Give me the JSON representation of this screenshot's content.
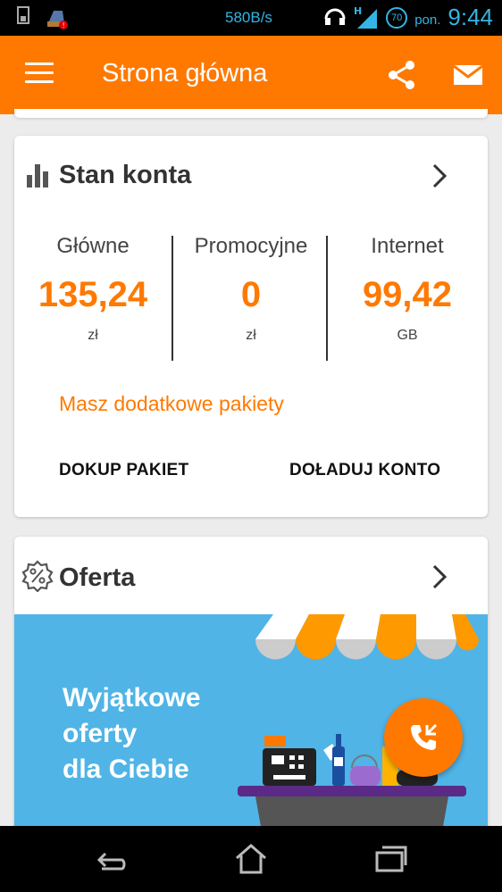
{
  "status_bar": {
    "net_speed": "580B/s",
    "battery": "70",
    "day": "pon.",
    "time": "9:44"
  },
  "app_bar": {
    "title": "Strona główna",
    "accent": "#ff7900"
  },
  "account_card": {
    "title": "Stan konta",
    "balances": [
      {
        "label": "Główne",
        "value": "135,24",
        "unit": "zł"
      },
      {
        "label": "Promocyjne",
        "value": "0",
        "unit": "zł"
      },
      {
        "label": "Internet",
        "value": "99,42",
        "unit": "GB"
      }
    ],
    "extra_packages_link": "Masz dodatkowe pakiety",
    "buy_package_button": "DOKUP PAKIET",
    "top_up_button": "DOŁADUJ KONTO"
  },
  "offer_card": {
    "title": "Oferta",
    "banner_lines": [
      "Wyjątkowe",
      "oferty",
      "dla Ciebie"
    ],
    "banner_color": "#50b4e6"
  },
  "icons": {
    "menu": "hamburger-icon",
    "share": "share-icon",
    "mail": "mail-icon",
    "chart": "bar-chart-icon",
    "percent": "percent-badge-icon",
    "chevron": "chevron-right-icon",
    "fab": "phone-callback-icon",
    "nav_back": "back-icon",
    "nav_home": "home-icon",
    "nav_recent": "recent-apps-icon"
  }
}
